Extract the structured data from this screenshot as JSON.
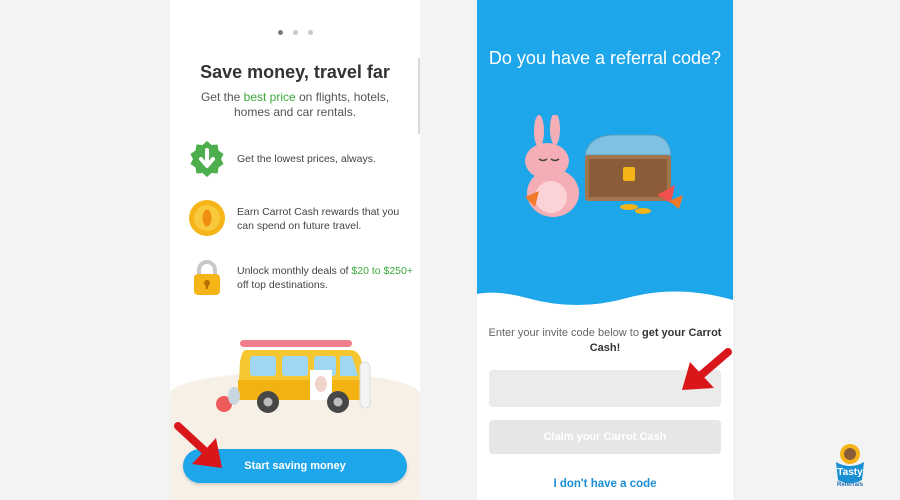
{
  "left_screen": {
    "title": "Save money, travel far",
    "subtitle_before": "Get the ",
    "subtitle_highlight": "best price",
    "subtitle_after": " on flights, hotels, homes and car rentals.",
    "features": [
      {
        "icon": "down-arrow-badge-icon",
        "text_before": "Get the lowest prices",
        "text_highlight": "",
        "text_after": ", always."
      },
      {
        "icon": "coin-icon",
        "text_before": "Earn Carrot Cash rewards that you can spend on future travel.",
        "text_highlight": "",
        "text_after": ""
      },
      {
        "icon": "padlock-icon",
        "text_before": "Unlock monthly deals of ",
        "text_highlight": "$20 to $250+",
        "text_after": " off top destinations."
      }
    ],
    "button_label": "Start saving money",
    "page_indicator": {
      "total": 3,
      "active": 1
    }
  },
  "right_screen": {
    "title": "Do you have a referral code?",
    "invite_text_before": "Enter your invite code below to ",
    "invite_text_bold": "get your Carrot Cash!",
    "code_input": {
      "value": "",
      "placeholder": ""
    },
    "claim_button_label": "Claim your Carrot Cash",
    "no_code_link": "I don't have a code"
  },
  "logo": {
    "line1": "Tasty",
    "line2": "Referrals"
  },
  "colors": {
    "brand_blue": "#1ea6ea",
    "link_blue": "#1b8fd3",
    "accent_green": "#3aa83a",
    "arrow_red": "#d9171b",
    "background": "#f3f3f3"
  }
}
